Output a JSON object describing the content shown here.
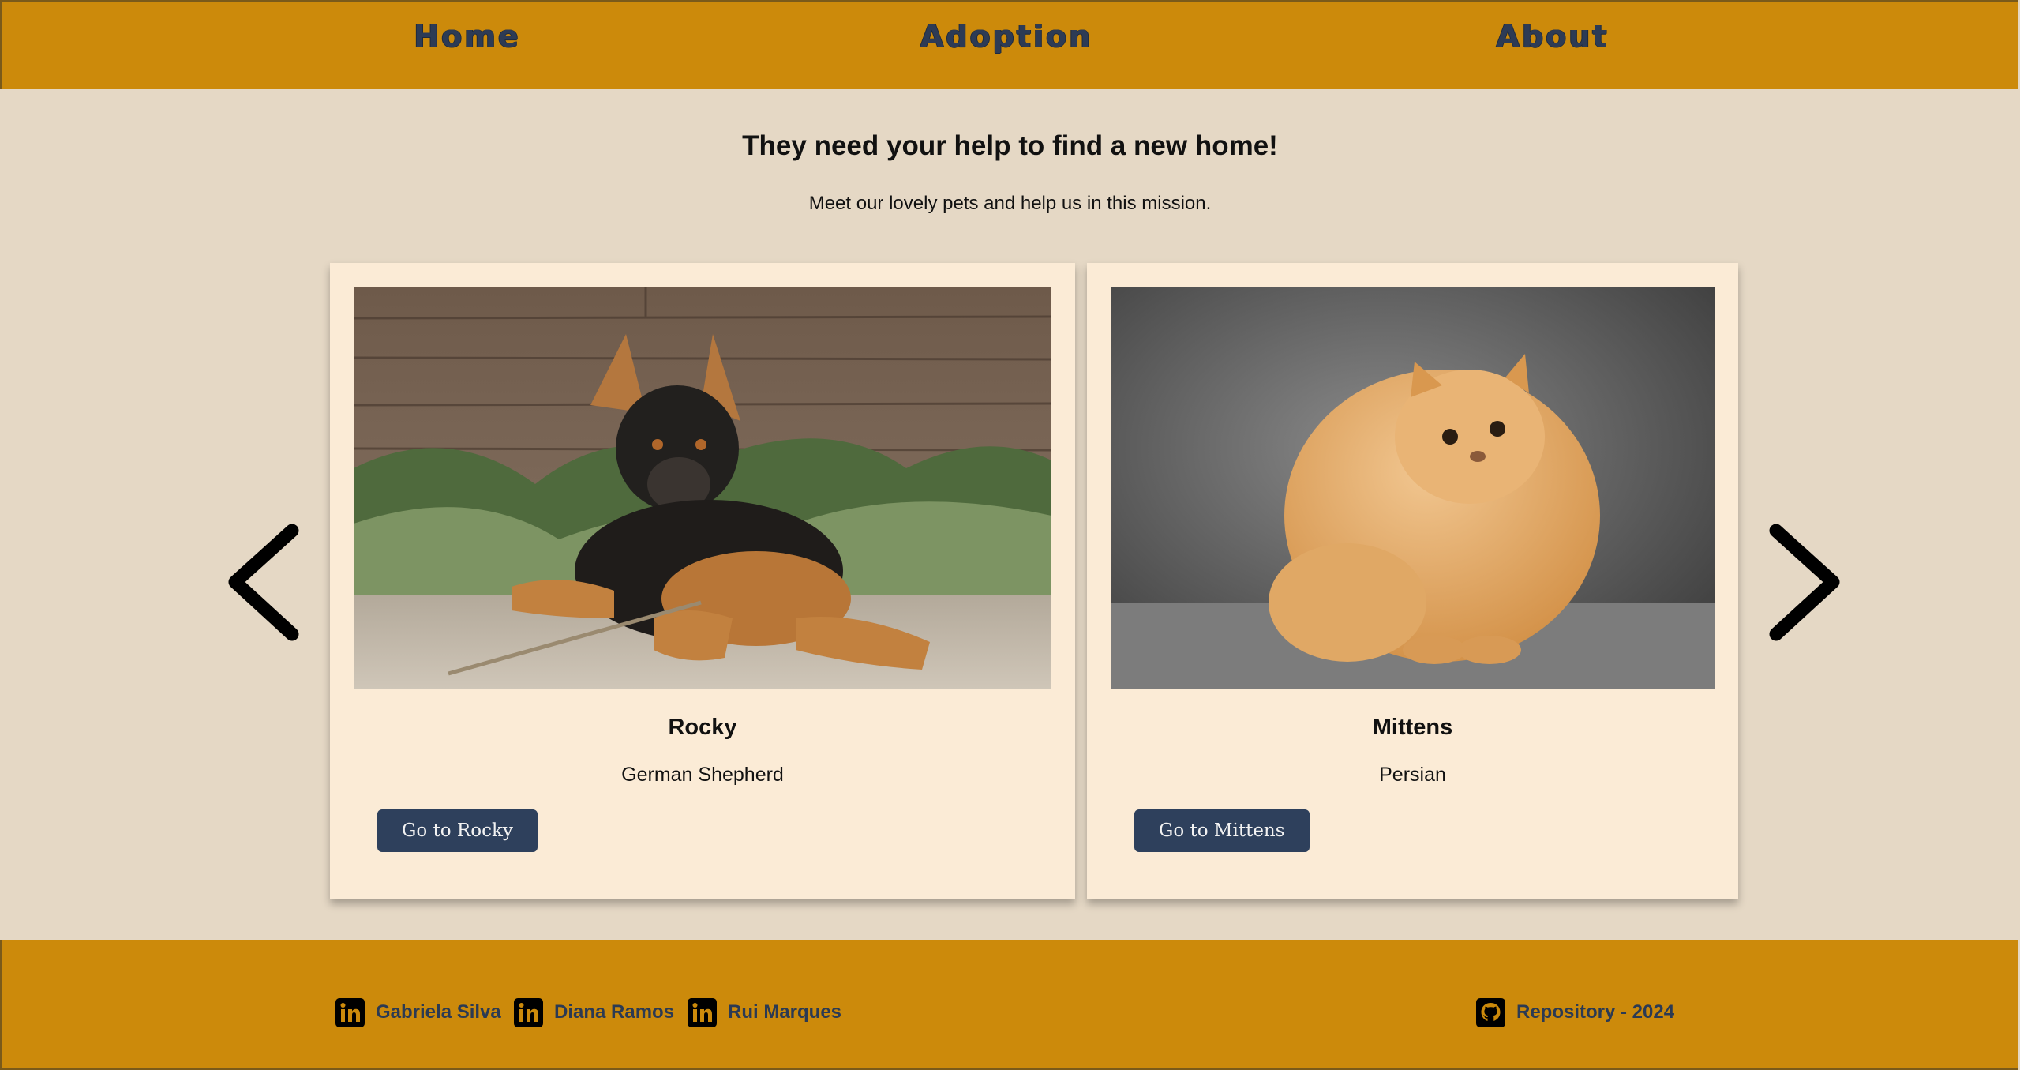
{
  "nav": {
    "home": "Home",
    "adoption": "Adoption",
    "about": "About"
  },
  "intro": {
    "heading": "They need your help to find a new home!",
    "subheading": "Meet our lovely pets and help us in this mission."
  },
  "carousel": {
    "prev_icon": "chevron-left-icon",
    "next_icon": "chevron-right-icon",
    "pets": [
      {
        "name": "Rocky",
        "breed": "German Shepherd",
        "button": "Go to Rocky"
      },
      {
        "name": "Mittens",
        "breed": "Persian",
        "button": "Go to Mittens"
      }
    ]
  },
  "footer": {
    "authors": [
      {
        "icon": "linkedin-icon",
        "name": "Gabriela Silva"
      },
      {
        "icon": "linkedin-icon",
        "name": "Diana Ramos"
      },
      {
        "icon": "linkedin-icon",
        "name": "Rui Marques"
      }
    ],
    "repository": {
      "icon": "github-icon",
      "label": "Repository - 2024"
    }
  },
  "colors": {
    "header_bg": "#cc8a0b",
    "page_bg": "#e5d8c5",
    "card_bg": "#fbebd6",
    "button_bg": "#2e405c",
    "nav_text": "#2d3b55"
  }
}
